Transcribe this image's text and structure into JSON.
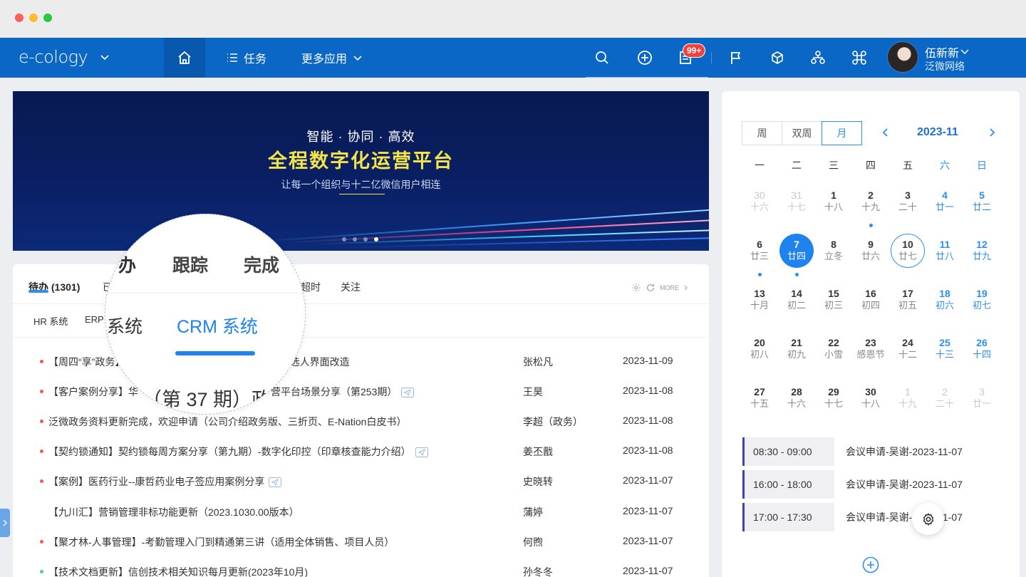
{
  "nav": {
    "brand": "e-cology",
    "task_label": "任务",
    "more_apps_label": "更多应用",
    "badge": "99+",
    "user_name": "伍新新",
    "user_org": "泛微网络"
  },
  "banner": {
    "subtitle": "智能 · 协同 · 高效",
    "title": "全程数字化运营平台",
    "description": "让每一个组织与十二亿微信用户相连"
  },
  "todo": {
    "tabs": [
      "待办 (1301)",
      "已",
      "超时",
      "关注"
    ],
    "more_label": "MORE",
    "subtabs": [
      "HR 系统",
      "ERP"
    ],
    "magnifier": {
      "tab1": "办",
      "tab2": "跟踪",
      "tab3": "完成",
      "sub1": "系统",
      "sub2": "CRM 系统",
      "row_text_a": "（第 37 期）政"
    },
    "rows": [
      {
        "title": "【周四“享”政务】",
        "title_tail": "(E10）、选人界面改造",
        "person": "张松凡",
        "date": "2023-11-09",
        "bullet": "red"
      },
      {
        "title": "【客户案例分享】华",
        "title_tail": "营平台场景分享（第253期）",
        "person": "王昊",
        "date": "2023-11-08",
        "bullet": "red"
      },
      {
        "title": "泛微政务资料更新完成，欢迎申请（公司介绍政务版、三折页、E-Nation白皮书）",
        "title_tail": "",
        "person": "李超（政务）",
        "date": "2023-11-08",
        "bullet": "red"
      },
      {
        "title": "【契约锁通知】契约锁每周方案分享（第九期）-数字化印控（印章核查能力介绍）",
        "title_tail": "",
        "person": "姜丕戬",
        "date": "2023-11-08",
        "bullet": "red"
      },
      {
        "title": "【案例】医药行业--康哲药业电子签应用案例分享",
        "title_tail": "",
        "person": "史晓转",
        "date": "2023-11-07",
        "bullet": "red"
      },
      {
        "title": "【九川汇】营销管理非标功能更新（2023.1030.00版本）",
        "title_tail": "",
        "person": "蒲婷",
        "date": "2023-11-07",
        "bullet": "none"
      },
      {
        "title": "【聚才林-人事管理】-考勤管理入门到精通第三讲（适用全体销售、项目人员）",
        "title_tail": "",
        "person": "何煦",
        "date": "2023-11-07",
        "bullet": "red"
      },
      {
        "title": "【技术文档更新】信创技术相关知识每月更新(2023年10月)",
        "title_tail": "",
        "person": "孙冬冬",
        "date": "2023-11-07",
        "bullet": "green"
      }
    ]
  },
  "calendar": {
    "views": [
      "周",
      "双周",
      "月"
    ],
    "active_view": "月",
    "month": "2023-11",
    "weekdays": [
      "一",
      "二",
      "三",
      "四",
      "五",
      "六",
      "日"
    ],
    "weeks": [
      [
        {
          "d": "30",
          "l": "十六",
          "o": true
        },
        {
          "d": "31",
          "l": "十七",
          "o": true
        },
        {
          "d": "1",
          "l": "十八"
        },
        {
          "d": "2",
          "l": "十九",
          "dot": true
        },
        {
          "d": "3",
          "l": "二十"
        },
        {
          "d": "4",
          "l": "廿一"
        },
        {
          "d": "5",
          "l": "廿二"
        }
      ],
      [
        {
          "d": "6",
          "l": "廿三",
          "dot": true
        },
        {
          "d": "7",
          "l": "廿四",
          "today": true,
          "dot": true
        },
        {
          "d": "8",
          "l": "立冬"
        },
        {
          "d": "9",
          "l": "廿六"
        },
        {
          "d": "10",
          "l": "廿七",
          "sel": true
        },
        {
          "d": "11",
          "l": "廿八"
        },
        {
          "d": "12",
          "l": "廿九"
        }
      ],
      [
        {
          "d": "13",
          "l": "十月"
        },
        {
          "d": "14",
          "l": "初二"
        },
        {
          "d": "15",
          "l": "初三"
        },
        {
          "d": "16",
          "l": "初四"
        },
        {
          "d": "17",
          "l": "初五"
        },
        {
          "d": "18",
          "l": "初六"
        },
        {
          "d": "19",
          "l": "初七"
        }
      ],
      [
        {
          "d": "20",
          "l": "初八"
        },
        {
          "d": "21",
          "l": "初九"
        },
        {
          "d": "22",
          "l": "小雪"
        },
        {
          "d": "23",
          "l": "感恩节"
        },
        {
          "d": "24",
          "l": "十二"
        },
        {
          "d": "25",
          "l": "十三"
        },
        {
          "d": "26",
          "l": "十四"
        }
      ],
      [
        {
          "d": "27",
          "l": "十五"
        },
        {
          "d": "28",
          "l": "十六"
        },
        {
          "d": "29",
          "l": "十七"
        },
        {
          "d": "30",
          "l": "十八"
        },
        {
          "d": "1",
          "l": "十九",
          "o": true
        },
        {
          "d": "2",
          "l": "二十",
          "o": true
        },
        {
          "d": "3",
          "l": "廿一",
          "o": true
        }
      ]
    ],
    "events": [
      {
        "time": "08:30 - 09:00",
        "title": "会议申请-吴谢-2023-11-07"
      },
      {
        "time": "16:00 - 18:00",
        "title": "会议申请-吴谢-2023-11-07"
      },
      {
        "time": "17:00 - 17:30",
        "title": "会议申请-吴谢-2023-11-07"
      }
    ]
  },
  "colors": {
    "nav_bg": "#0a67c5",
    "accent": "#2c8ff0",
    "banner_title": "#f3e44a"
  }
}
